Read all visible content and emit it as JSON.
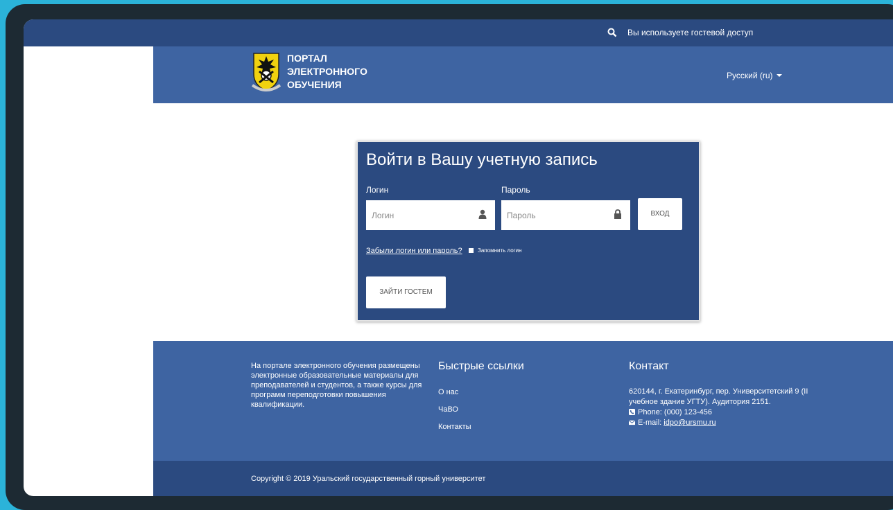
{
  "topbar": {
    "guest_text": "Вы используете гостевой доступ"
  },
  "header": {
    "logo_lines": [
      "ПОРТАЛ",
      "ЭЛЕКТРОННОГО",
      "ОБУЧЕНИЯ"
    ],
    "language": "Русский (ru)"
  },
  "login": {
    "title": "Войти в Вашу учетную запись",
    "username_label": "Логин",
    "username_placeholder": "Логин",
    "password_label": "Пароль",
    "password_placeholder": "Пароль",
    "login_button": "ВХОД",
    "forgot_link": "Забыли логин или пароль?",
    "remember_label": "Запомнить логин",
    "guest_button": "ЗАЙТИ ГОСТЕМ"
  },
  "footer": {
    "about": "На портале электронного обучения размещены электронные образовательные материалы для преподавателей и студентов, а также курсы для программ переподготовки повышения квалификации.",
    "links_title": "Быстрые ссылки",
    "links": [
      "О нас",
      "ЧаВО",
      "Контакты"
    ],
    "contact_title": "Контакт",
    "address": "620144, г. Екатеринбург, пер. Университетский 9 (II учебное здание УГТУ). Аудитория 2151.",
    "phone": "Phone: (000) 123-456",
    "email_label": "E-mail:",
    "email": "idpo@ursmu.ru"
  },
  "copyright": "Copyright © 2019 Уральский государственный горный университет",
  "colors": {
    "dark_blue": "#2b4a80",
    "header_blue": "#3e64a2",
    "outer_bg": "#2bb3d9",
    "logo_yellow": "#f1d20f"
  },
  "icons": [
    "search-icon",
    "user-icon",
    "lock-icon",
    "phone-icon",
    "envelope-icon",
    "university-logo"
  ]
}
